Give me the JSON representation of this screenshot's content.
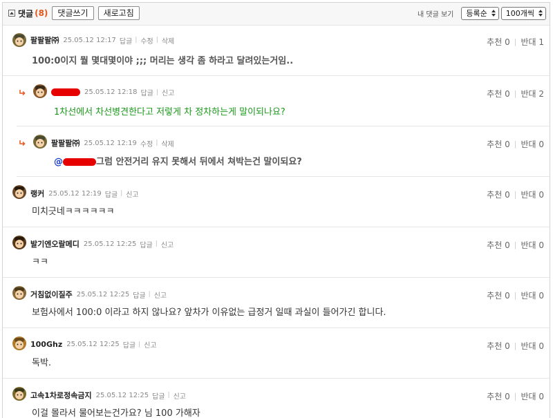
{
  "toolbar": {
    "title": "댓글",
    "count": "(8)",
    "write_label": "댓글쓰기",
    "refresh_label": "새로고침",
    "mine_label": "내 댓글 보기",
    "sort_value": "등록순",
    "perpage_value": "100개씩"
  },
  "comments": [
    {
      "nick": "팔팔팔㈜",
      "date": "25.05.12 12:17",
      "actions": [
        "답글",
        "수정",
        "삭제"
      ],
      "text": "100:0이지 뭘 몇대몇이야 ;;; 머리는 생각 좀 하라고 달려있는거임..",
      "up_label": "추천",
      "up": "0",
      "down_label": "반대",
      "down": "1"
    },
    {
      "nick": "",
      "date": "25.05.12 12:18",
      "actions": [
        "답글",
        "신고"
      ],
      "text": "1차선에서 차선병견한다고 저렇게 차 정차하는게 말이되나요?",
      "up_label": "추천",
      "up": "0",
      "down_label": "반대",
      "down": "2"
    },
    {
      "nick": "팔팔팔㈜",
      "date": "25.05.12 12:19",
      "actions": [
        "수정",
        "삭제"
      ],
      "mention": "@",
      "text": "그럼 안전거리 유지 못해서 뒤에서 쳐박는건 말이되요?",
      "up_label": "추천",
      "up": "0",
      "down_label": "반대",
      "down": "0"
    },
    {
      "nick": "랭커",
      "date": "25.05.12 12:19",
      "actions": [
        "답글",
        "신고"
      ],
      "text": "미치긋네ㅋㅋㅋㅋㅋㅋ",
      "up_label": "추천",
      "up": "0",
      "down_label": "반대",
      "down": "0"
    },
    {
      "nick": "발기엔오랄메디",
      "date": "25.05.12 12:25",
      "actions": [
        "답글",
        "신고"
      ],
      "text": "ㅋㅋ",
      "up_label": "추천",
      "up": "0",
      "down_label": "반대",
      "down": "0"
    },
    {
      "nick": "거침없이질주",
      "date": "25.05.12 12:25",
      "actions": [
        "답글",
        "신고"
      ],
      "text": "보험사에서 100:0 이라고 하지 않나요? 앞차가 이유없는 급정거 일때 과실이 들어가긴 합니다.",
      "up_label": "추천",
      "up": "0",
      "down_label": "반대",
      "down": "0"
    },
    {
      "nick": "100Ghz",
      "date": "25.05.12 12:25",
      "actions": [
        "답글",
        "신고"
      ],
      "text": "독박.",
      "up_label": "추천",
      "up": "0",
      "down_label": "반대",
      "down": "0"
    },
    {
      "nick": "고속1차로정속금지",
      "date": "25.05.12 12:25",
      "actions": [
        "답글",
        "신고"
      ],
      "text": "이걸 몰라서 물어보는건가요? 님 100 가해자",
      "up_label": "추천",
      "up": "0",
      "down_label": "반대",
      "down": "0"
    }
  ]
}
